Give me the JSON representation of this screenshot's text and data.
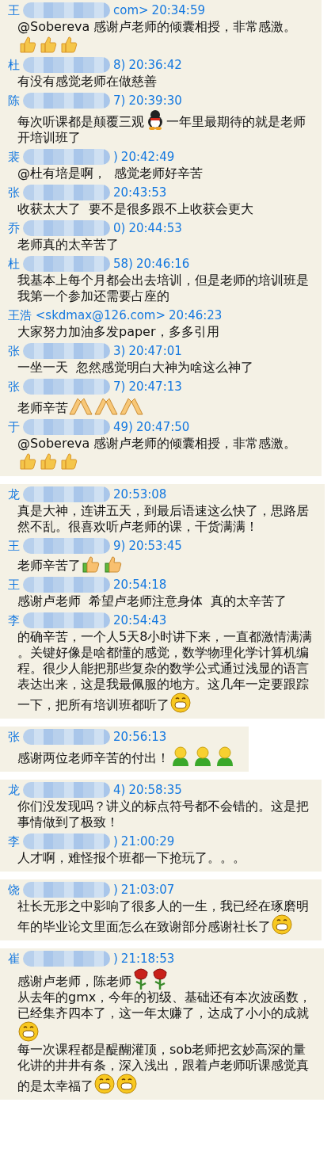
{
  "panels": [
    {
      "messages": [
        {
          "name_start": "王",
          "blurred": true,
          "name_end": "com>",
          "time": "20:34:59",
          "parts": [
            {
              "kind": "text",
              "text": "@Sobereva 感谢卢老师的倾囊相授，非常感激。"
            },
            {
              "kind": "break"
            },
            {
              "kind": "thumb"
            },
            {
              "kind": "thumb"
            },
            {
              "kind": "thumb"
            }
          ]
        },
        {
          "name_start": "杜",
          "blurred": true,
          "name_end": "8)",
          "time": "20:36:42",
          "parts": [
            {
              "kind": "text",
              "text": "有没有感觉老师在做慈善"
            }
          ]
        },
        {
          "name_start": "陈",
          "blurred": true,
          "name_end": "7)",
          "time": "20:39:30",
          "parts": [
            {
              "kind": "text",
              "text": "每次听课都是颠覆三观"
            },
            {
              "kind": "penguin"
            },
            {
              "kind": "text",
              "text": "一年里最期待的就是老师"
            },
            {
              "kind": "break"
            },
            {
              "kind": "text",
              "text": "开培训班了"
            }
          ]
        },
        {
          "name_start": "裴",
          "blurred": true,
          "name_end": ")",
          "time": "20:42:49",
          "parts": [
            {
              "kind": "text",
              "text": "@杜有培是啊，  感觉老师好辛苦"
            }
          ]
        },
        {
          "name_start": "张",
          "blurred": true,
          "time": "20:43:53",
          "parts": [
            {
              "kind": "text",
              "text": "收获太大了  要不是很多跟不上收获会更大"
            }
          ]
        },
        {
          "name_start": "乔",
          "blurred": true,
          "name_end": "0)",
          "time": "20:44:53",
          "parts": [
            {
              "kind": "text",
              "text": "老师真的太辛苦了"
            }
          ]
        },
        {
          "name_start": "杜",
          "blurred": true,
          "name_end": "58)",
          "time": "20:46:16",
          "parts": [
            {
              "kind": "text",
              "text": "我基本上每个月都会出去培训，但是老师的培训班是"
            },
            {
              "kind": "break"
            },
            {
              "kind": "text",
              "text": "我第一个参加还需要占座的"
            }
          ]
        },
        {
          "name_start": "王浩 <skdmax@126.com>",
          "blurred": false,
          "time": "20:46:23",
          "parts": [
            {
              "kind": "text",
              "text": "大家努力加油多发paper，多多引用"
            }
          ]
        },
        {
          "name_start": "张",
          "blurred": true,
          "name_end": "3)",
          "time": "20:47:01",
          "parts": [
            {
              "kind": "text",
              "text": "一坐一天  忽然感觉明白大神为啥这么神了"
            }
          ]
        },
        {
          "name_start": "张",
          "blurred": true,
          "name_end": "7)",
          "time": "20:47:13",
          "parts": [
            {
              "kind": "text",
              "text": "老师辛苦"
            },
            {
              "kind": "hands"
            },
            {
              "kind": "hands"
            },
            {
              "kind": "hands"
            }
          ]
        },
        {
          "name_start": "于",
          "blurred": true,
          "name_end": "49)",
          "time": "20:47:50",
          "parts": [
            {
              "kind": "text",
              "text": "@Sobereva 感谢卢老师的倾囊相授，非常感激。"
            },
            {
              "kind": "break"
            },
            {
              "kind": "thumb"
            },
            {
              "kind": "thumb"
            },
            {
              "kind": "thumb"
            }
          ]
        }
      ]
    },
    {
      "messages": [
        {
          "name_start": "龙",
          "blurred": true,
          "time": "20:53:08",
          "parts": [
            {
              "kind": "text",
              "text": "真是大神，连讲五天，到最后语速这么快了，思路居"
            },
            {
              "kind": "break"
            },
            {
              "kind": "text",
              "text": "然不乱。很喜欢听卢老师的课，干货满满！"
            }
          ]
        },
        {
          "name_start": "王",
          "blurred": true,
          "name_end": "9)",
          "time": "20:53:45",
          "parts": [
            {
              "kind": "text",
              "text": "老师辛苦了"
            },
            {
              "kind": "thumb_cuff"
            },
            {
              "kind": "thumb_cuff"
            }
          ]
        },
        {
          "name_start": "王",
          "blurred": true,
          "time": "20:54:18",
          "parts": [
            {
              "kind": "text",
              "text": "感谢卢老师  希望卢老师注意身体  真的太辛苦了"
            }
          ]
        },
        {
          "name_start": "李",
          "blurred": true,
          "time": "20:54:43",
          "parts": [
            {
              "kind": "text",
              "text": "的确辛苦，一个人5天8小时讲下来，一直都激情满满"
            },
            {
              "kind": "break"
            },
            {
              "kind": "text",
              "text": "。关键好像是啥都懂的感觉，数学物理化学计算机编"
            },
            {
              "kind": "break"
            },
            {
              "kind": "text",
              "text": "程。很少人能把那些复杂的数学公式通过浅显的语言"
            },
            {
              "kind": "break"
            },
            {
              "kind": "text",
              "text": "表达出来，这是我最佩服的地方。这几年一定要跟踪"
            },
            {
              "kind": "break"
            },
            {
              "kind": "text",
              "text": "一下，把所有培训班都听了"
            },
            {
              "kind": "grin"
            }
          ]
        }
      ]
    },
    {
      "messages": [
        {
          "name_start": "张",
          "blurred": true,
          "time": "20:56:13",
          "parts": [
            {
              "kind": "text",
              "text": "感谢两位老师辛苦的付出！"
            },
            {
              "kind": "figure"
            },
            {
              "kind": "figure"
            },
            {
              "kind": "figure"
            }
          ]
        }
      ]
    },
    {
      "messages": [
        {
          "name_start": "龙",
          "blurred": true,
          "name_end": "4)",
          "time": "20:58:35",
          "parts": [
            {
              "kind": "text",
              "text": "你们没发现吗？讲义的标点符号都不会错的。这是把"
            },
            {
              "kind": "break"
            },
            {
              "kind": "text",
              "text": "事情做到了极致！"
            }
          ]
        },
        {
          "name_start": "李",
          "blurred": true,
          "name_end": ")",
          "time": "21:00:29",
          "parts": [
            {
              "kind": "text",
              "text": "人才啊，难怪报个班都一下抢玩了。。。"
            }
          ]
        }
      ]
    },
    {
      "messages": [
        {
          "name_start": "饶",
          "blurred": true,
          "name_end": ")",
          "time": "21:03:07",
          "parts": [
            {
              "kind": "text",
              "text": "社长无形之中影响了很多人的一生，我已经在琢磨明"
            },
            {
              "kind": "break"
            },
            {
              "kind": "text",
              "text": "年的毕业论文里面怎么在致谢部分感谢社长了"
            },
            {
              "kind": "grin"
            }
          ]
        }
      ]
    },
    {
      "messages": [
        {
          "name_start": "崔",
          "blurred": true,
          "name_end": ")",
          "time": "21:18:53",
          "parts": [
            {
              "kind": "text",
              "text": "感谢卢老师，陈老师"
            },
            {
              "kind": "rose"
            },
            {
              "kind": "rose"
            },
            {
              "kind": "break"
            },
            {
              "kind": "text",
              "text": "从去年的gmx，今年的初级、基础还有本次波函数，"
            },
            {
              "kind": "break"
            },
            {
              "kind": "text",
              "text": "已经集齐四本了，这一年太赚了，达成了小小的成就"
            },
            {
              "kind": "break"
            },
            {
              "kind": "grin"
            },
            {
              "kind": "break"
            },
            {
              "kind": "text",
              "text": "每一次课程都是醍醐灌顶，sob老师把玄妙高深的量"
            },
            {
              "kind": "break"
            },
            {
              "kind": "text",
              "text": "化讲的井井有条，深入浅出，跟着卢老师听课感觉真"
            },
            {
              "kind": "break"
            },
            {
              "kind": "text",
              "text": "的是太幸福了"
            },
            {
              "kind": "grin"
            },
            {
              "kind": "grin"
            }
          ]
        }
      ]
    }
  ]
}
